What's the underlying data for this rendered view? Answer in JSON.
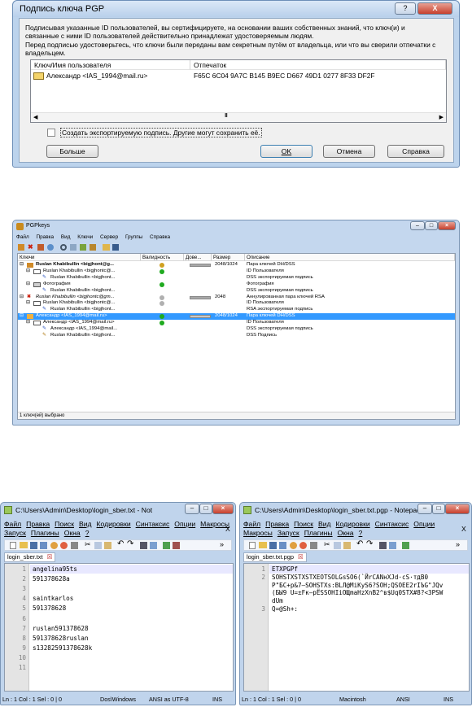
{
  "dialog": {
    "title": "Подпись ключа PGP",
    "help_btn": "?",
    "close_btn": "X",
    "text1": "Подписывая указанные ID пользователей, вы сертифицируете, на основании ваших собственных знаний, что ключ(и) и связанные с ними ID пользователей действительно принадлежат удостоверяемым людям.",
    "text2": "Перед подписью удостоверьтесь, что ключи были переданы вам секретным путём от владельца, или что вы сверили отпечатки с владельцем.",
    "col_key": "Ключ/Имя пользователя",
    "col_fp": "Отпечаток",
    "row_user": "Александр <IAS_1994@mail.ru>",
    "row_fp": "F65C 6C04 9A7C B145 B9EC  D667 49D1 0277 8F33 DF2F",
    "scroll_mid": "III",
    "export_label": "Создать экспортируемую подпись. Другие могут сохранить её.",
    "more_btn": "Больше",
    "ok_btn": "OK",
    "cancel_btn": "Отмена",
    "help_button": "Справка"
  },
  "pgpkeys": {
    "title": "PGPkeys",
    "menu": [
      "Файл",
      "Правка",
      "Вид",
      "Ключи",
      "Сервер",
      "Группы",
      "Справка"
    ],
    "headers": [
      "Ключи",
      "Валидность",
      "Дове...",
      "Размер",
      "Описание"
    ],
    "rows": [
      {
        "name": "Ruslan Khabibullin <bigjhont@g...",
        "size": "2048/1024",
        "desc": "Пара ключей DH/DSS"
      },
      {
        "name": "Ruslan Khabibullin <bigjhontc@...",
        "size": "",
        "desc": "ID Пользователя"
      },
      {
        "name": "Ruslan Khabibullin <bigjhont...",
        "size": "",
        "desc": "DSS экспортируемая подпись"
      },
      {
        "name": "Фотография",
        "size": "",
        "desc": "Фотография"
      },
      {
        "name": "Ruslan Khabibullin <bigjhont...",
        "size": "",
        "desc": "DSS экспортируемая подпись"
      },
      {
        "name": "Ruslan Khabibullin <bigjhontc@gm...",
        "size": "2048",
        "desc": "Аннулированная пара ключей RSA"
      },
      {
        "name": "Ruslan Khabibullin <bigjhontc@...",
        "size": "",
        "desc": "ID Пользователя"
      },
      {
        "name": "Ruslan Khabibullin <bigjhont...",
        "size": "",
        "desc": "RSA экспортируемая подпись"
      },
      {
        "name": "Александр <IAS_1994@mail.ru>",
        "size": "2048/1024",
        "desc": "Пара ключей DH/DSS"
      },
      {
        "name": "Александр <IAS_1994@mail.ru>",
        "size": "",
        "desc": "ID Пользователя"
      },
      {
        "name": "Александр <IAS_1994@mail...",
        "size": "",
        "desc": "DSS экспортируемая подпись"
      },
      {
        "name": "Ruslan Khabibullin <bigjhont...",
        "size": "",
        "desc": "DSS Подпись"
      }
    ],
    "status": "1 ключ(ей) выбрано"
  },
  "np1": {
    "title": "C:\\Users\\Admin\\Desktop\\login_sber.txt - Notepad++ [Admi...",
    "menu1": [
      "Файл",
      "Правка",
      "Поиск",
      "Вид",
      "Кодировки",
      "Синтаксис",
      "Опции",
      "Макросы"
    ],
    "menu2": [
      "Запуск",
      "Плагины",
      "Окна",
      "?"
    ],
    "close_x": "X",
    "tab": "login_sber.txt",
    "lines": [
      "angelina95ts",
      "591378628a",
      "",
      "saintkarlos",
      "591378628",
      "",
      "ruslan591378628",
      "591378628ruslan",
      "s13282591378628k",
      "",
      ""
    ],
    "status": {
      "pos": "Ln : 1   Col : 1   Sel : 0 | 0",
      "eol": "Dos\\Windows",
      "enc": "ANSI as UTF-8",
      "ins": "INS"
    }
  },
  "np2": {
    "title": "C:\\Users\\Admin\\Desktop\\login_sber.txt.pgp - Notepad...",
    "menu1": [
      "Файл",
      "Правка",
      "Поиск",
      "Вид",
      "Кодировки",
      "Синтаксис",
      "Опции"
    ],
    "menu2": [
      "Макросы",
      "Запуск",
      "Плагины",
      "Окна",
      "?"
    ],
    "close_x": "X",
    "tab": "login_sber.txt.pgp",
    "lines": [
      "ETXPGPf",
      "SOHSTXSTXSTXEOTSOLGsSO6(`ЙrCANнXJd·cS·тдВ0",
      "Р\"БС+р&7—SOHSTXs:BLЛ@MiKyS6?SOH;QSOEE2rIЪG\"JQv",
      "(БЫ9 U=±Fк—рЁSSOHIiOЩmaHzXnB2^в$Uq0STX#8?<3PSW",
      "dUm",
      "Q=@Sh+:"
    ],
    "line_numbers": [
      "1",
      "2",
      "",
      "",
      "",
      "3"
    ],
    "status": {
      "pos": "Ln : 1   Col : 1   Sel : 0 | 0",
      "eol": "Macintosh",
      "enc": "ANSI",
      "ins": "INS"
    }
  }
}
